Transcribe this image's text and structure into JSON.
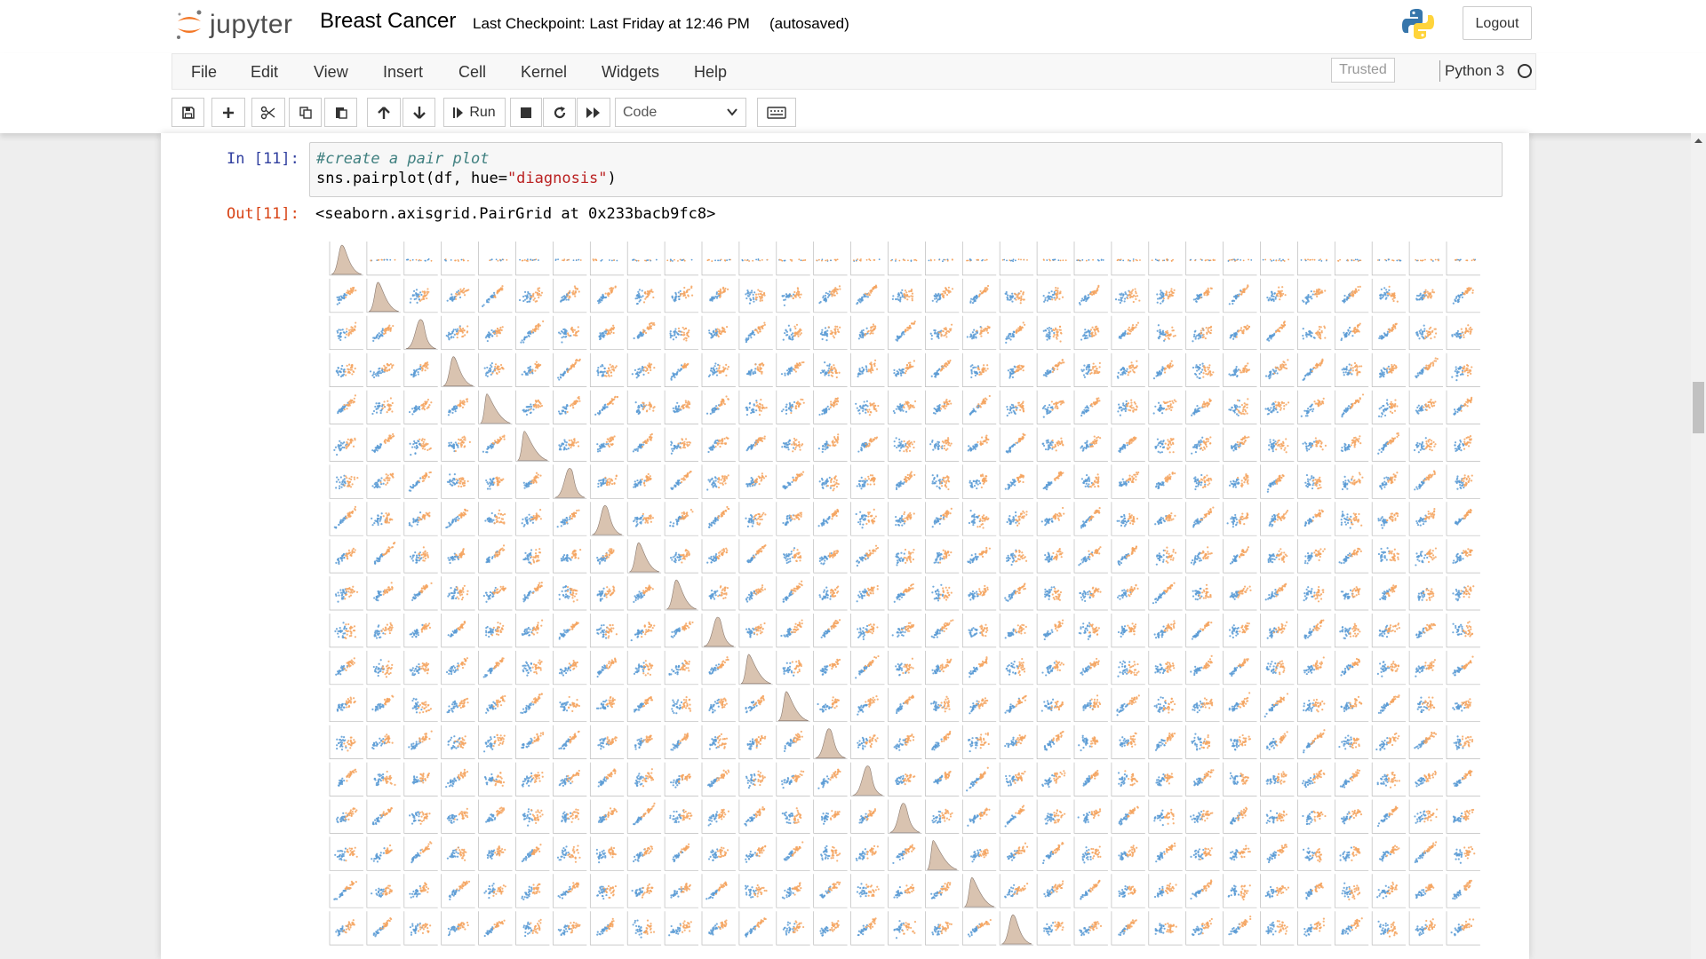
{
  "header": {
    "logo_text": "jupyter",
    "notebook_title": "Breast Cancer",
    "checkpoint": "Last Checkpoint: Last Friday at 12:46 PM",
    "autosave": "(autosaved)",
    "logout_label": "Logout"
  },
  "menubar": {
    "items": [
      "File",
      "Edit",
      "View",
      "Insert",
      "Cell",
      "Kernel",
      "Widgets",
      "Help"
    ],
    "trusted_label": "Trusted",
    "kernel_name": "Python 3"
  },
  "toolbar": {
    "buttons": [
      "save-icon",
      "plus-icon",
      "cut-icon",
      "copy-icon",
      "paste-icon",
      "arrow-up-icon",
      "arrow-down-icon",
      "run-icon",
      "stop-icon",
      "restart-icon",
      "fast-forward-icon",
      "keyboard-icon"
    ],
    "run_label": "Run",
    "cell_type": "Code"
  },
  "cells": {
    "input_prompt": "In [11]:",
    "code_comment": "#create a pair plot",
    "code_prefix": "sns.pairplot(df, hue=",
    "code_string": "\"diagnosis\"",
    "code_suffix": ")",
    "output_prompt": "Out[11]:",
    "output_text": "<seaborn.axisgrid.PairGrid at 0x233bacb9fc8>"
  },
  "chart_data": {
    "type": "scatter",
    "title": "",
    "hue": "diagnosis",
    "grid_columns": 31,
    "visible_rows": 19,
    "series": [
      {
        "color": "#5b9bd5"
      },
      {
        "color": "#f4a460"
      }
    ]
  },
  "colors": {
    "series_a": "#5b9bd5",
    "series_b": "#f4a460",
    "kde_fill": "#c9a98e",
    "jupyter_orange": "#f37726"
  }
}
